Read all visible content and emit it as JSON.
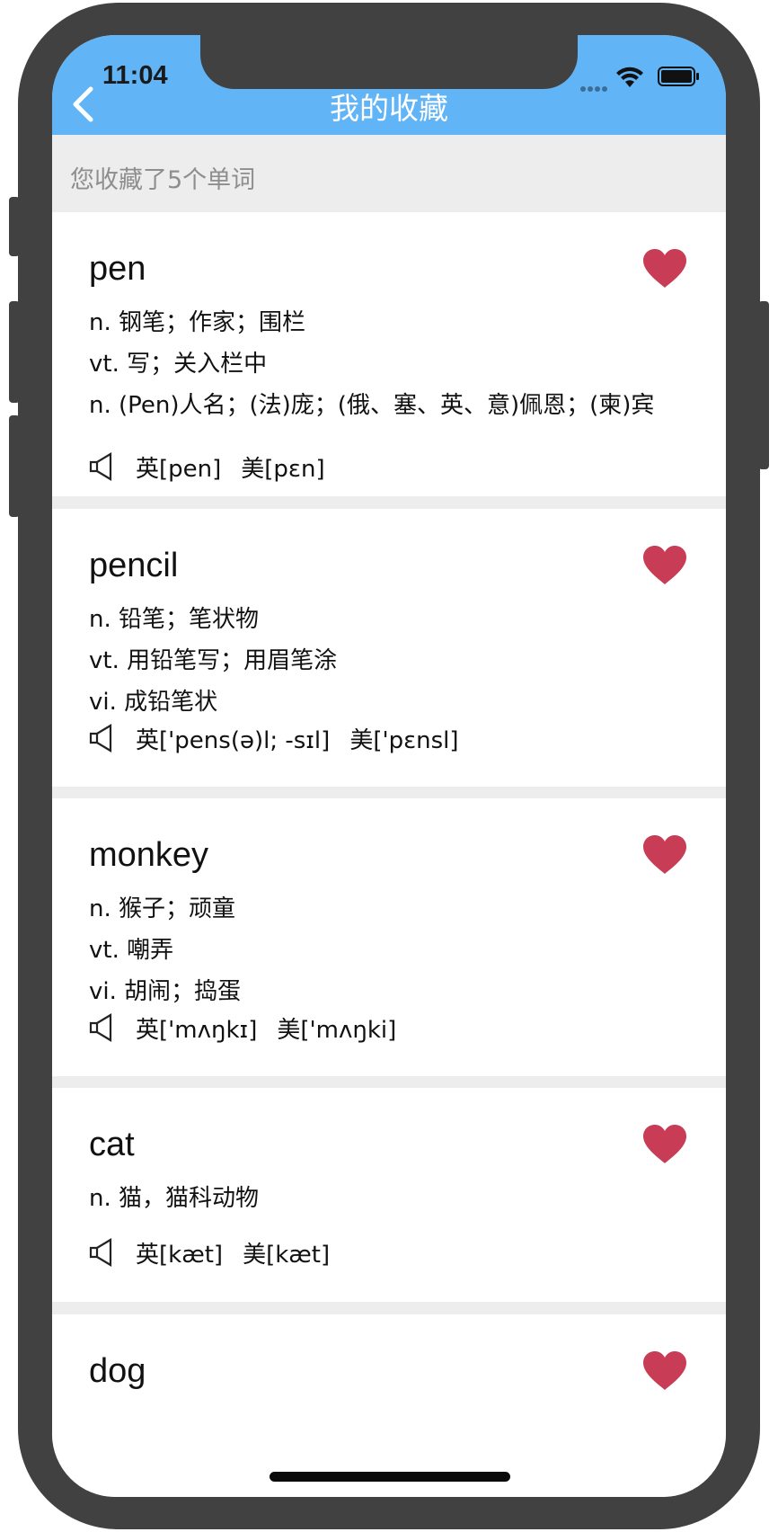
{
  "status_bar": {
    "time": "11:04"
  },
  "nav": {
    "title": "我的收藏",
    "back_icon": "chevron-left-icon"
  },
  "summary": {
    "text": "您收藏了5个单词"
  },
  "colors": {
    "header_bg": "#61b4f6",
    "heart": "#c83c56",
    "separator": "#ededed",
    "summary_text": "#8e8e8e"
  },
  "words": [
    {
      "word": "pen",
      "definitions": [
        "n. 钢笔；作家；围栏",
        "vt. 写；关入栏中",
        "n. (Pen)人名；(法)庞；(俄、塞、英、意)佩恩；(柬)宾"
      ],
      "uk": "英[pen]",
      "us": "美[pɛn]",
      "favorited": true
    },
    {
      "word": "pencil",
      "definitions": [
        "n. 铅笔；笔状物",
        "vt. 用铅笔写；用眉笔涂",
        "vi. 成铅笔状"
      ],
      "uk": "英['pens(ə)l; -sɪl]",
      "us": "美['pɛnsl]",
      "favorited": true
    },
    {
      "word": "monkey",
      "definitions": [
        "n. 猴子；顽童",
        "vt. 嘲弄",
        "vi. 胡闹；捣蛋"
      ],
      "uk": "英['mʌŋkɪ]",
      "us": "美['mʌŋki]",
      "favorited": true
    },
    {
      "word": "cat",
      "definitions": [
        "n. 猫，猫科动物"
      ],
      "uk": "英[kæt]",
      "us": "美[kæt]",
      "favorited": true
    },
    {
      "word": "dog",
      "definitions": [],
      "uk": "",
      "us": "",
      "favorited": true
    }
  ]
}
